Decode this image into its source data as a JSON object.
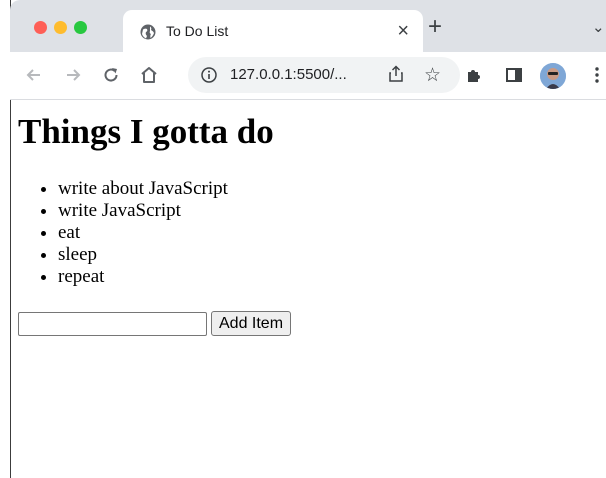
{
  "window": {
    "tab": {
      "title": "To Do List",
      "icon": "globe-icon"
    },
    "controls": [
      "close",
      "minimize",
      "maximize"
    ]
  },
  "toolbar": {
    "url": "127.0.0.1:5500/...",
    "icons": [
      "back-arrow-icon",
      "forward-arrow-icon",
      "reload-icon",
      "home-icon",
      "info-icon",
      "share-icon",
      "star-icon",
      "extensions-puzzle-icon",
      "side-panel-icon",
      "avatar",
      "menu-dots-icon"
    ]
  },
  "page": {
    "heading": "Things I gotta do",
    "items": [
      "write about JavaScript",
      "write JavaScript",
      "eat",
      "sleep",
      "repeat"
    ],
    "input": {
      "value": "",
      "placeholder": ""
    },
    "add_button_label": "Add Item"
  },
  "colors": {
    "tabstrip_bg": "#dee1e6",
    "omnibox_bg": "#f1f3f4",
    "traffic_red": "#fe5f57",
    "traffic_yellow": "#febc2e",
    "traffic_green": "#28c840"
  }
}
